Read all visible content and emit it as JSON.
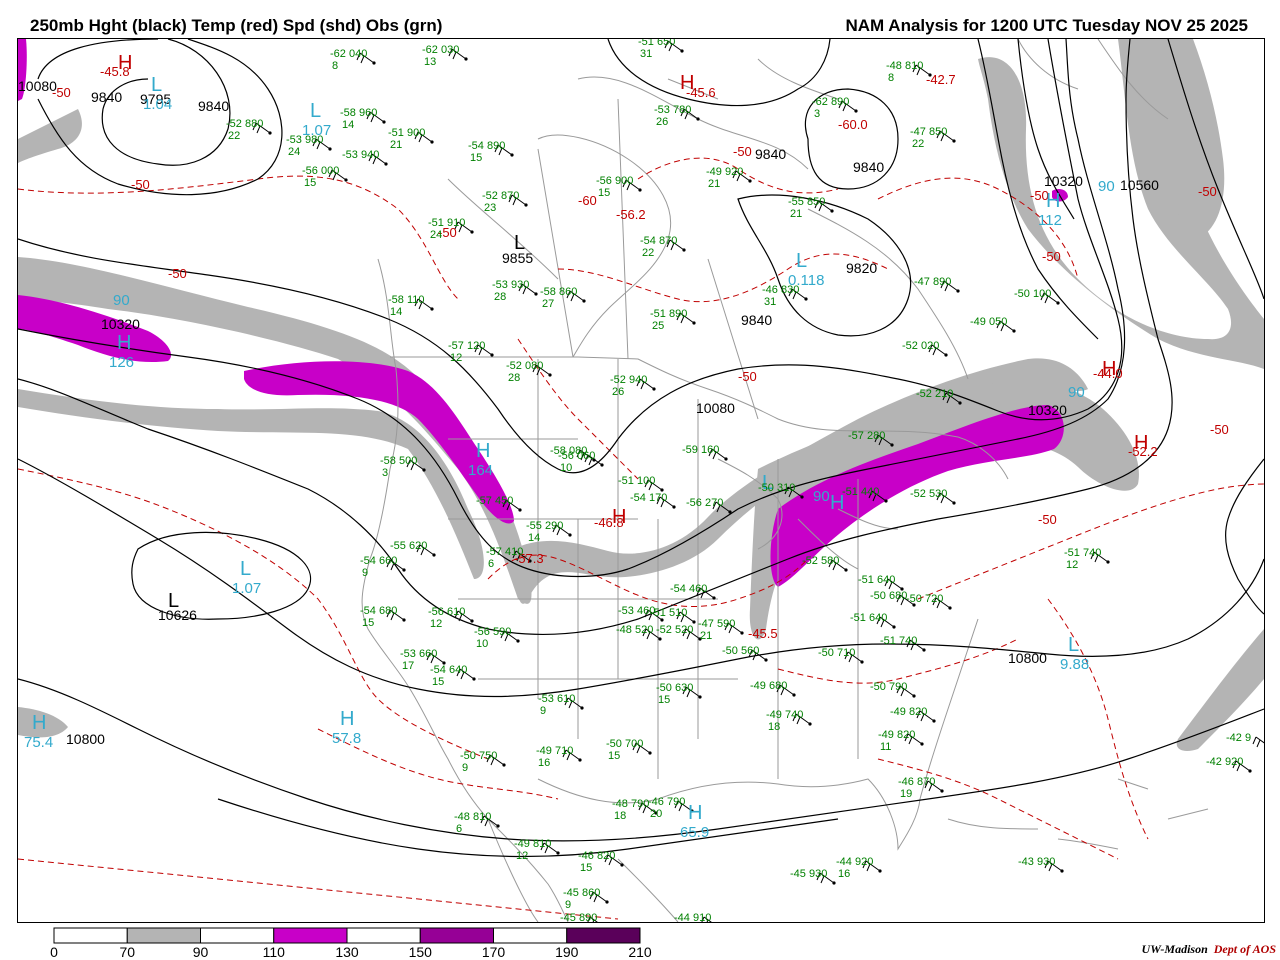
{
  "header": {
    "left_title": "250mb Hght (black) Temp (red) Spd (shd) Obs (grn)",
    "right_title": "NAM Analysis for 1200 UTC Tuesday  NOV 25 2025"
  },
  "colors": {
    "height_contour": "#000000",
    "temp_contour": "#c00000",
    "speed_70_90": "#b4b4b4",
    "speed_110_130": "#c800c8",
    "speed_150_170": "#960096",
    "speed_190_210": "#5a005a",
    "obs": "#008000",
    "speed_center": "#33aacc",
    "borders": "#9a9a9a"
  },
  "colorbar": {
    "ticks": [
      "0",
      "70",
      "90",
      "110",
      "130",
      "150",
      "170",
      "190",
      "210"
    ],
    "fills": [
      "#ffffff",
      "#b4b4b4",
      "#ffffff",
      "#c800c8",
      "#ffffff",
      "#960096",
      "#ffffff",
      "#5a005a"
    ]
  },
  "credit": {
    "org": "UW-Madison",
    "dept": "Dept of AOS"
  },
  "height_labels": [
    "10080",
    "9840",
    "9795",
    "9840",
    "9840",
    "9840",
    "9855",
    "9820",
    "9840",
    "10320",
    "10320",
    "10560",
    "10320",
    "10080",
    "10626",
    "10800",
    "10800"
  ],
  "temp_labels": [
    "-45.8",
    "-50",
    "-50",
    "-50",
    "-60",
    "-45.6",
    "-56.2",
    "-50",
    "-60.0",
    "-42.7",
    "-50",
    "-50",
    "-50",
    "-44.0",
    "-52.2",
    "-50",
    "-50",
    "-46.8",
    "-57.3",
    "-45.5",
    "-50",
    "-50"
  ],
  "pressure_centers": [
    {
      "type": "H",
      "value": ""
    },
    {
      "type": "L",
      "value": "1.04"
    },
    {
      "type": "L",
      "value": "1.07"
    },
    {
      "type": "H",
      "value": ""
    },
    {
      "type": "L",
      "value": ""
    },
    {
      "type": "L",
      "value": "0.118"
    },
    {
      "type": "H",
      "value": "112"
    },
    {
      "type": "H",
      "value": "126"
    },
    {
      "type": "H",
      "value": "164"
    },
    {
      "type": "L",
      "value": "1.07"
    },
    {
      "type": "L",
      "value": ""
    },
    {
      "type": "H",
      "value": ""
    },
    {
      "type": "H",
      "value": ""
    },
    {
      "type": "H",
      "value": "57.8"
    },
    {
      "type": "H",
      "value": "75.4"
    },
    {
      "type": "H",
      "value": "65.9"
    },
    {
      "type": "L",
      "value": "9.88"
    },
    {
      "type": "H",
      "value": ""
    },
    {
      "type": "L",
      "value": ""
    },
    {
      "type": "H",
      "value": ""
    }
  ],
  "speed_labels": [
    "90",
    "90",
    "90",
    "90"
  ],
  "observations": [
    {
      "temp": "-62",
      "hgt": "040",
      "dew": "8"
    },
    {
      "temp": "-62",
      "hgt": "030",
      "dew": "13"
    },
    {
      "temp": "-58",
      "hgt": "960",
      "dew": "14"
    },
    {
      "temp": "-52",
      "hgt": "880",
      "dew": "22"
    },
    {
      "temp": "-53",
      "hgt": "980",
      "dew": "24"
    },
    {
      "temp": "-51",
      "hgt": "900",
      "dew": "21"
    },
    {
      "temp": "-53",
      "hgt": "940",
      "dew": ""
    },
    {
      "temp": "-56",
      "hgt": "000",
      "dew": "15"
    },
    {
      "temp": "-54",
      "hgt": "890",
      "dew": "15"
    },
    {
      "temp": "-52",
      "hgt": "870",
      "dew": "23"
    },
    {
      "temp": "-56",
      "hgt": "900",
      "dew": "15"
    },
    {
      "temp": "-49",
      "hgt": "920",
      "dew": "21"
    },
    {
      "temp": "-53",
      "hgt": "780",
      "dew": "26"
    },
    {
      "temp": "-51",
      "hgt": "650",
      "dew": "31"
    },
    {
      "temp": "-62",
      "hgt": "890",
      "dew": "3"
    },
    {
      "temp": "-48",
      "hgt": "810",
      "dew": "8"
    },
    {
      "temp": "-47",
      "hgt": "850",
      "dew": "22"
    },
    {
      "temp": "-55",
      "hgt": "850",
      "dew": "21"
    },
    {
      "temp": "-54",
      "hgt": "870",
      "dew": "22"
    },
    {
      "temp": "-51",
      "hgt": "910",
      "dew": "24"
    },
    {
      "temp": "-53",
      "hgt": "930",
      "dew": "28"
    },
    {
      "temp": "-58",
      "hgt": "860",
      "dew": "27"
    },
    {
      "temp": "-51",
      "hgt": "890",
      "dew": "25"
    },
    {
      "temp": "-46",
      "hgt": "830",
      "dew": "31"
    },
    {
      "temp": "-47",
      "hgt": "890",
      "dew": ""
    },
    {
      "temp": "-50",
      "hgt": "100",
      "dew": ""
    },
    {
      "temp": "-49",
      "hgt": "050",
      "dew": ""
    },
    {
      "temp": "-58",
      "hgt": "110",
      "dew": "14"
    },
    {
      "temp": "-57",
      "hgt": "120",
      "dew": "12"
    },
    {
      "temp": "-52",
      "hgt": "080",
      "dew": "28"
    },
    {
      "temp": "-52",
      "hgt": "020",
      "dew": ""
    },
    {
      "temp": "-52",
      "hgt": "940",
      "dew": "26"
    },
    {
      "temp": "-58",
      "hgt": "080",
      "dew": ""
    },
    {
      "temp": "-52",
      "hgt": "210",
      "dew": ""
    },
    {
      "temp": "-57",
      "hgt": "280",
      "dew": ""
    },
    {
      "temp": "-58",
      "hgt": "500",
      "dew": "3"
    },
    {
      "temp": "-56",
      "hgt": "060",
      "dew": "10"
    },
    {
      "temp": "-59",
      "hgt": "160",
      "dew": ""
    },
    {
      "temp": "-51",
      "hgt": "100",
      "dew": ""
    },
    {
      "temp": "-54",
      "hgt": "170",
      "dew": ""
    },
    {
      "temp": "-56",
      "hgt": "270",
      "dew": ""
    },
    {
      "temp": "-50",
      "hgt": "310",
      "dew": ""
    },
    {
      "temp": "-51",
      "hgt": "440",
      "dew": ""
    },
    {
      "temp": "-52",
      "hgt": "530",
      "dew": ""
    },
    {
      "temp": "-57",
      "hgt": "450",
      "dew": ""
    },
    {
      "temp": "-55",
      "hgt": "620",
      "dew": ""
    },
    {
      "temp": "-57",
      "hgt": "410",
      "dew": "6"
    },
    {
      "temp": "-55",
      "hgt": "290",
      "dew": "14"
    },
    {
      "temp": "-54",
      "hgt": "660",
      "dew": "9"
    },
    {
      "temp": "-51",
      "hgt": "740",
      "dew": "12"
    },
    {
      "temp": "-54",
      "hgt": "680",
      "dew": "15"
    },
    {
      "temp": "-56",
      "hgt": "610",
      "dew": "12"
    },
    {
      "temp": "-56",
      "hgt": "590",
      "dew": "10"
    },
    {
      "temp": "-54",
      "hgt": "460",
      "dew": ""
    },
    {
      "temp": "-53",
      "hgt": "460",
      "dew": ""
    },
    {
      "temp": "-51",
      "hgt": "510",
      "dew": ""
    },
    {
      "temp": "-52",
      "hgt": "520",
      "dew": ""
    },
    {
      "temp": "-50",
      "hgt": "560",
      "dew": ""
    },
    {
      "temp": "-47",
      "hgt": "590",
      "dew": "21"
    },
    {
      "temp": "-48",
      "hgt": "520",
      "dew": ""
    },
    {
      "temp": "-52",
      "hgt": "580",
      "dew": ""
    },
    {
      "temp": "-51",
      "hgt": "640",
      "dew": ""
    },
    {
      "temp": "-51",
      "hgt": "640",
      "dew": ""
    },
    {
      "temp": "-50",
      "hgt": "680",
      "dew": ""
    },
    {
      "temp": "-50",
      "hgt": "720",
      "dew": ""
    },
    {
      "temp": "-51",
      "hgt": "740",
      "dew": ""
    },
    {
      "temp": "-50",
      "hgt": "710",
      "dew": ""
    },
    {
      "temp": "-49",
      "hgt": "680",
      "dew": ""
    },
    {
      "temp": "-53",
      "hgt": "660",
      "dew": "17"
    },
    {
      "temp": "-54",
      "hgt": "640",
      "dew": "15"
    },
    {
      "temp": "-50",
      "hgt": "630",
      "dew": "15"
    },
    {
      "temp": "-53",
      "hgt": "610",
      "dew": "9"
    },
    {
      "temp": "-49",
      "hgt": "740",
      "dew": "18"
    },
    {
      "temp": "-50",
      "hgt": "790",
      "dew": ""
    },
    {
      "temp": "-49",
      "hgt": "820",
      "dew": ""
    },
    {
      "temp": "-49",
      "hgt": "820",
      "dew": "11"
    },
    {
      "temp": "-46",
      "hgt": "870",
      "dew": "19"
    },
    {
      "temp": "-50",
      "hgt": "750",
      "dew": "9"
    },
    {
      "temp": "-49",
      "hgt": "710",
      "dew": "16"
    },
    {
      "temp": "-50",
      "hgt": "700",
      "dew": "15"
    },
    {
      "temp": "-48",
      "hgt": "790",
      "dew": "18"
    },
    {
      "temp": "-46",
      "hgt": "790",
      "dew": "20"
    },
    {
      "temp": "-48",
      "hgt": "810",
      "dew": "6"
    },
    {
      "temp": "-49",
      "hgt": "810",
      "dew": "12"
    },
    {
      "temp": "-46",
      "hgt": "820",
      "dew": "15"
    },
    {
      "temp": "-45",
      "hgt": "860",
      "dew": "9"
    },
    {
      "temp": "-45",
      "hgt": "890",
      "dew": ""
    },
    {
      "temp": "-44",
      "hgt": "910",
      "dew": ""
    },
    {
      "temp": "-45",
      "hgt": "930",
      "dew": ""
    },
    {
      "temp": "-44",
      "hgt": "920",
      "dew": "16"
    },
    {
      "temp": "-43",
      "hgt": "930",
      "dew": ""
    },
    {
      "temp": "-42",
      "hgt": "920",
      "dew": ""
    },
    {
      "temp": "-42",
      "hgt": "9",
      "dew": ""
    }
  ]
}
